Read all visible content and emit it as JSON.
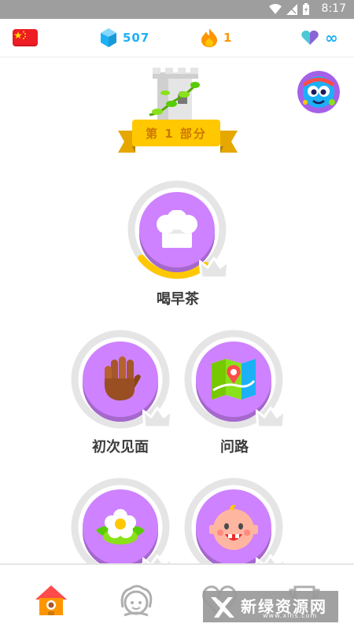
{
  "status_bar": {
    "time": "8:17"
  },
  "top_bar": {
    "course_flag": "china-flag-icon",
    "gems": "507",
    "streak": "1",
    "hearts": "∞"
  },
  "unit": {
    "label": "第 1 部分"
  },
  "skills": [
    {
      "label": "喝早茶",
      "icon": "chef-hat-icon",
      "progress": 0.25
    },
    {
      "label": "初次见面",
      "icon": "wave-hand-icon",
      "progress": 0
    },
    {
      "label": "问路",
      "icon": "map-icon",
      "progress": 0
    },
    {
      "label": "",
      "icon": "flower-icon",
      "progress": 0
    },
    {
      "label": "",
      "icon": "baby-face-icon",
      "progress": 0
    }
  ],
  "bottom_nav": [
    "home-icon",
    "profile-icon",
    "leagues-icon",
    "shop-icon"
  ],
  "watermark": {
    "text": "新绿资源网",
    "sub": "www.xlhs.com"
  },
  "colors": {
    "accent": "#1cb0f6",
    "skill": "#ce82ff",
    "banner": "#ffc800",
    "streak": "#ff9600"
  }
}
